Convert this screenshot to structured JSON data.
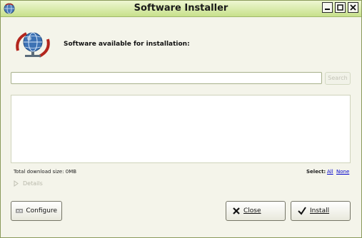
{
  "window": {
    "title": "Software Installer"
  },
  "header": {
    "label": "Software available for installation:"
  },
  "search": {
    "value": "",
    "button_label": "Search"
  },
  "footer": {
    "total_download": "Total download size: 0MB",
    "select_label": "Select:",
    "select_all": "All",
    "select_none": "None",
    "details_label": "Details"
  },
  "buttons": {
    "configure": "Configure",
    "close": "Close",
    "install": "Install"
  },
  "icons": {
    "title": "globe-icon",
    "header": "globe-network-icon",
    "configure": "computer-network-icon",
    "close": "x-icon",
    "install": "checkmark-icon"
  },
  "colors": {
    "titlebar": "#c7e08b",
    "link": "#0000cc"
  }
}
